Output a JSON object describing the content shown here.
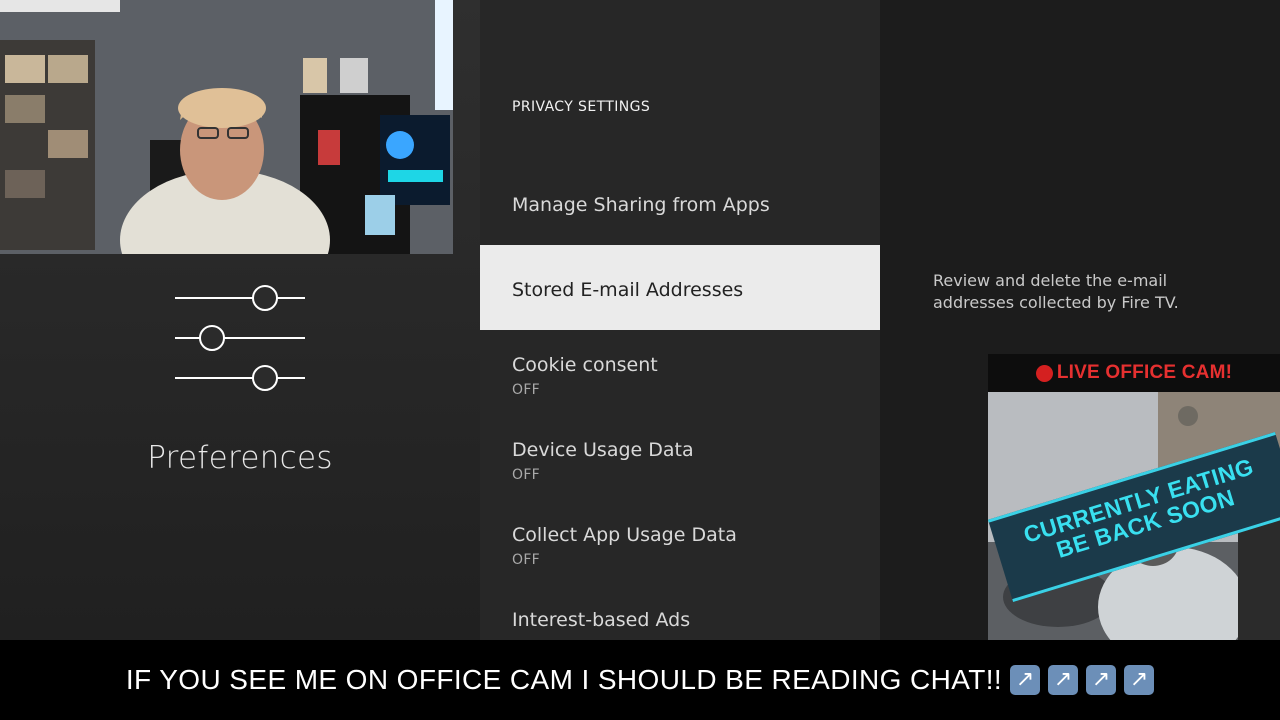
{
  "preferences": {
    "title": "Preferences",
    "icon": "sliders-icon"
  },
  "menu": {
    "section_title": "PRIVACY SETTINGS",
    "items": [
      {
        "label": "Manage Sharing from Apps",
        "sub": ""
      },
      {
        "label": "Stored E-mail Addresses",
        "sub": "",
        "selected": true
      },
      {
        "label": "Cookie consent",
        "sub": "OFF"
      },
      {
        "label": "Device Usage Data",
        "sub": "OFF"
      },
      {
        "label": "Collect App Usage Data",
        "sub": "OFF"
      },
      {
        "label": "Interest-based Ads",
        "sub": ""
      }
    ]
  },
  "detail": {
    "description": "Review and delete the e-mail addresses collected by Fire TV."
  },
  "office_cam": {
    "header": "LIVE OFFICE CAM!",
    "banner_line1": "CURRENTLY EATING",
    "banner_line2": "BE BACK SOON"
  },
  "ticker": {
    "text": "IF YOU SEE ME ON OFFICE CAM I SHOULD BE READING CHAT!!",
    "arrow_icon": "north-east-arrow-icon",
    "arrow_glyph": "↗"
  },
  "colors": {
    "selected_bg": "#ebebeb",
    "live_red": "#e63030",
    "banner_cyan": "#39e0f0",
    "arrow_blue": "#6c8fb8"
  }
}
